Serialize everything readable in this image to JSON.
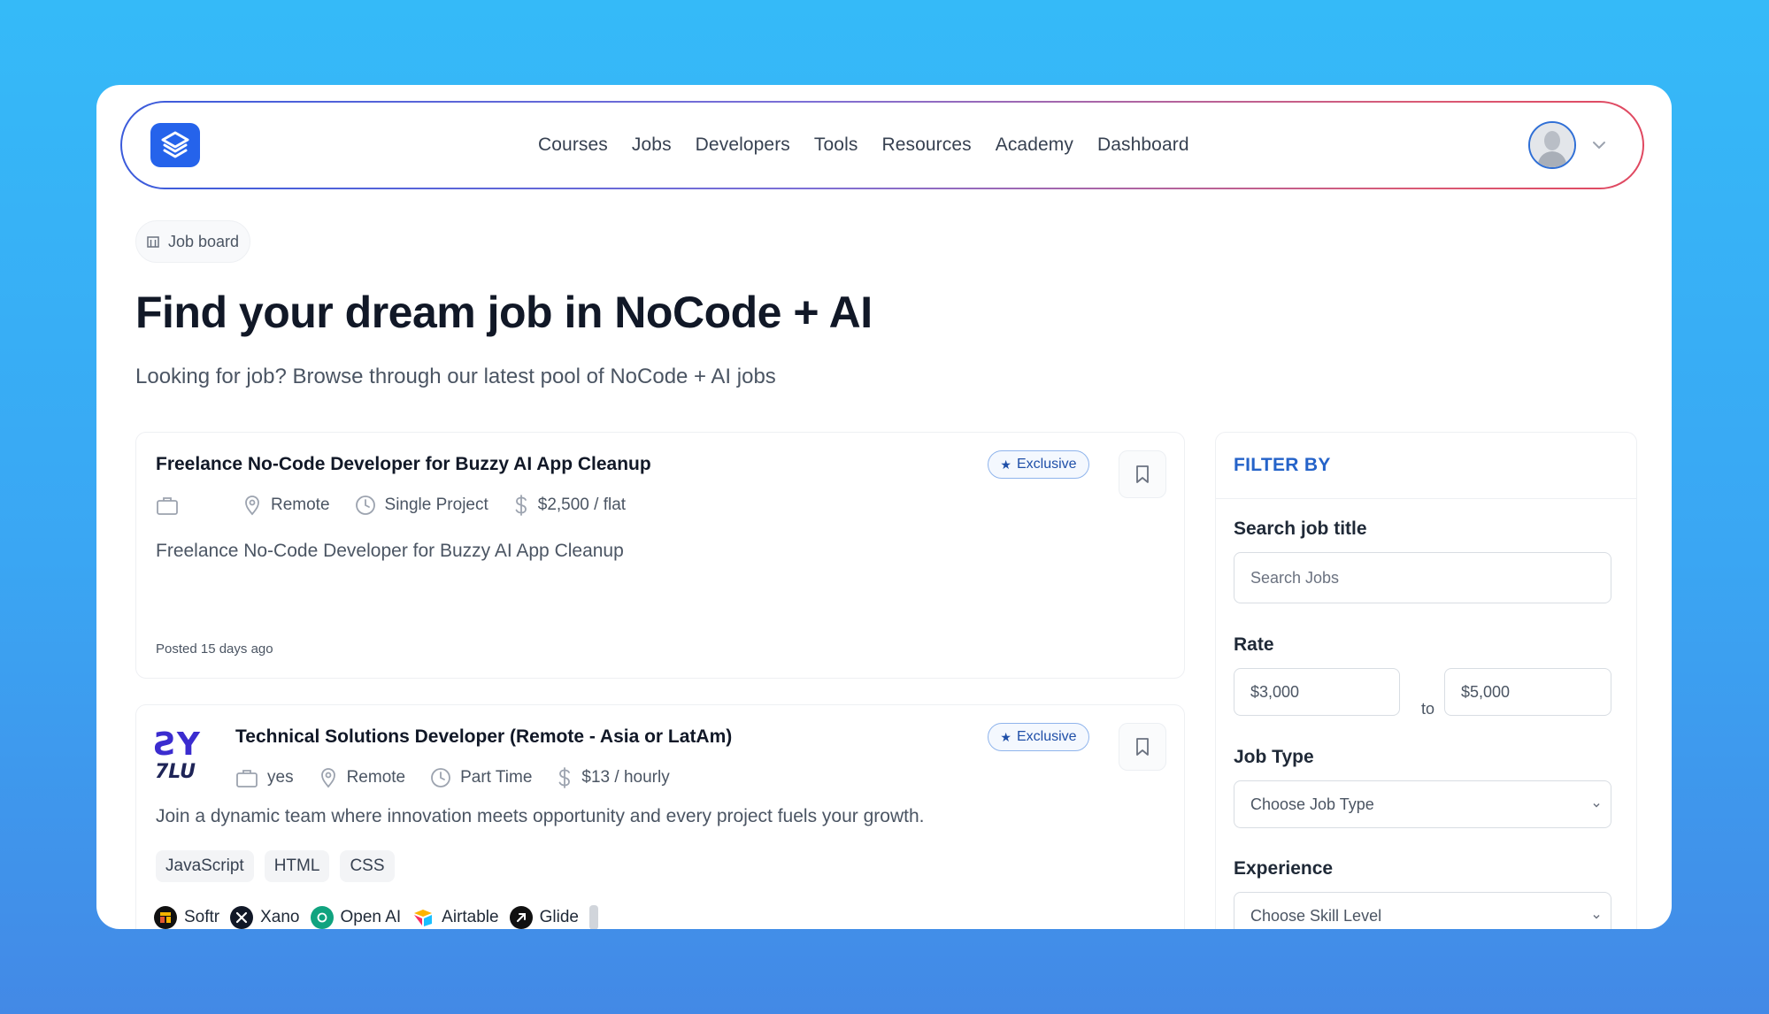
{
  "nav": {
    "items": [
      "Courses",
      "Jobs",
      "Developers",
      "Tools",
      "Resources",
      "Academy",
      "Dashboard"
    ]
  },
  "breadcrumb": {
    "label": "Job board"
  },
  "hero": {
    "title": "Find your dream job in NoCode + AI",
    "subtitle": "Looking for job? Browse through our latest pool of NoCode + AI jobs"
  },
  "jobs": [
    {
      "title": "Freelance No-Code Developer for Buzzy AI App Cleanup",
      "badge": "Exclusive",
      "location": "Remote",
      "type": "Single Project",
      "rate": "$2,500 / flat",
      "description": "Freelance No-Code Developer for Buzzy AI App Cleanup",
      "posted": "Posted 15 days ago"
    },
    {
      "title": "Technical Solutions Developer (Remote - Asia or LatAm)",
      "badge": "Exclusive",
      "company_field": "yes",
      "location": "Remote",
      "type": "Part Time",
      "rate": "$13 / hourly",
      "description": "Join a dynamic team where innovation meets opportunity and every project fuels your growth.",
      "tags": [
        "JavaScript",
        "HTML",
        "CSS"
      ],
      "tools": [
        "Softr",
        "Xano",
        "Open AI",
        "Airtable",
        "Glide"
      ]
    }
  ],
  "filter": {
    "heading": "FILTER BY",
    "search_label": "Search job title",
    "search_placeholder": "Search Jobs",
    "rate_label": "Rate",
    "rate_min": "$3,000",
    "rate_to": "to",
    "rate_max": "$5,000",
    "job_type_label": "Job Type",
    "job_type_value": "Choose Job Type",
    "experience_label": "Experience",
    "experience_value": "Choose Skill Level"
  },
  "colors": {
    "accent": "#2563eb",
    "badge_text": "#1f4fa8",
    "filter_heading": "#2563c9"
  }
}
